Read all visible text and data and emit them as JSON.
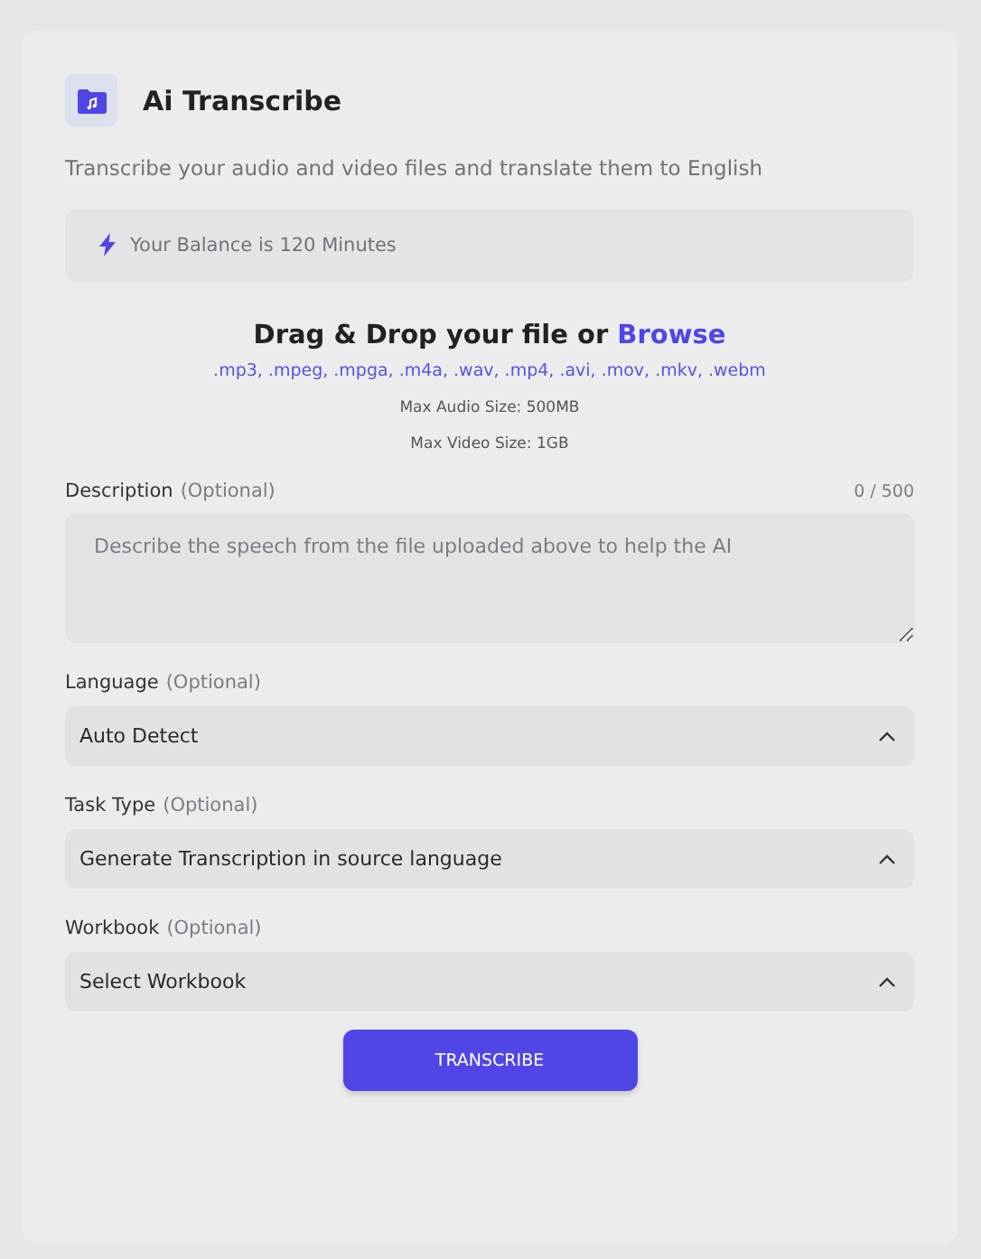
{
  "header": {
    "title": "Ai Transcribe",
    "subtitle": "Transcribe your audio and video files and translate them to English"
  },
  "balance": "Your Balance is 120 Minutes",
  "upload": {
    "prompt": "Drag & Drop your file or",
    "link": "Browse",
    "formats": ".mp3, .mpeg, .mpga, .m4a, .wav, .mp4, .avi, .mov, .mkv, .webm",
    "limits": [
      "Max Audio Size: 500MB",
      "Max Video Size: 1GB"
    ]
  },
  "description": {
    "label": "Description",
    "hint": "(Optional)",
    "counter": "0 / 500",
    "placeholder": "Describe the speech from the file uploaded above to help the AI"
  },
  "selects": [
    {
      "label": "Language",
      "hint": "(Optional)",
      "value": "Auto Detect",
      "expanded": true
    },
    {
      "label": "Task Type",
      "hint": "(Optional)",
      "value": "Generate Transcription in source language",
      "expanded": true
    },
    {
      "label": "Workbook",
      "hint": "(Optional)",
      "value": "Select Workbook",
      "expanded": true
    }
  ],
  "button": "TRANSCRIBE"
}
